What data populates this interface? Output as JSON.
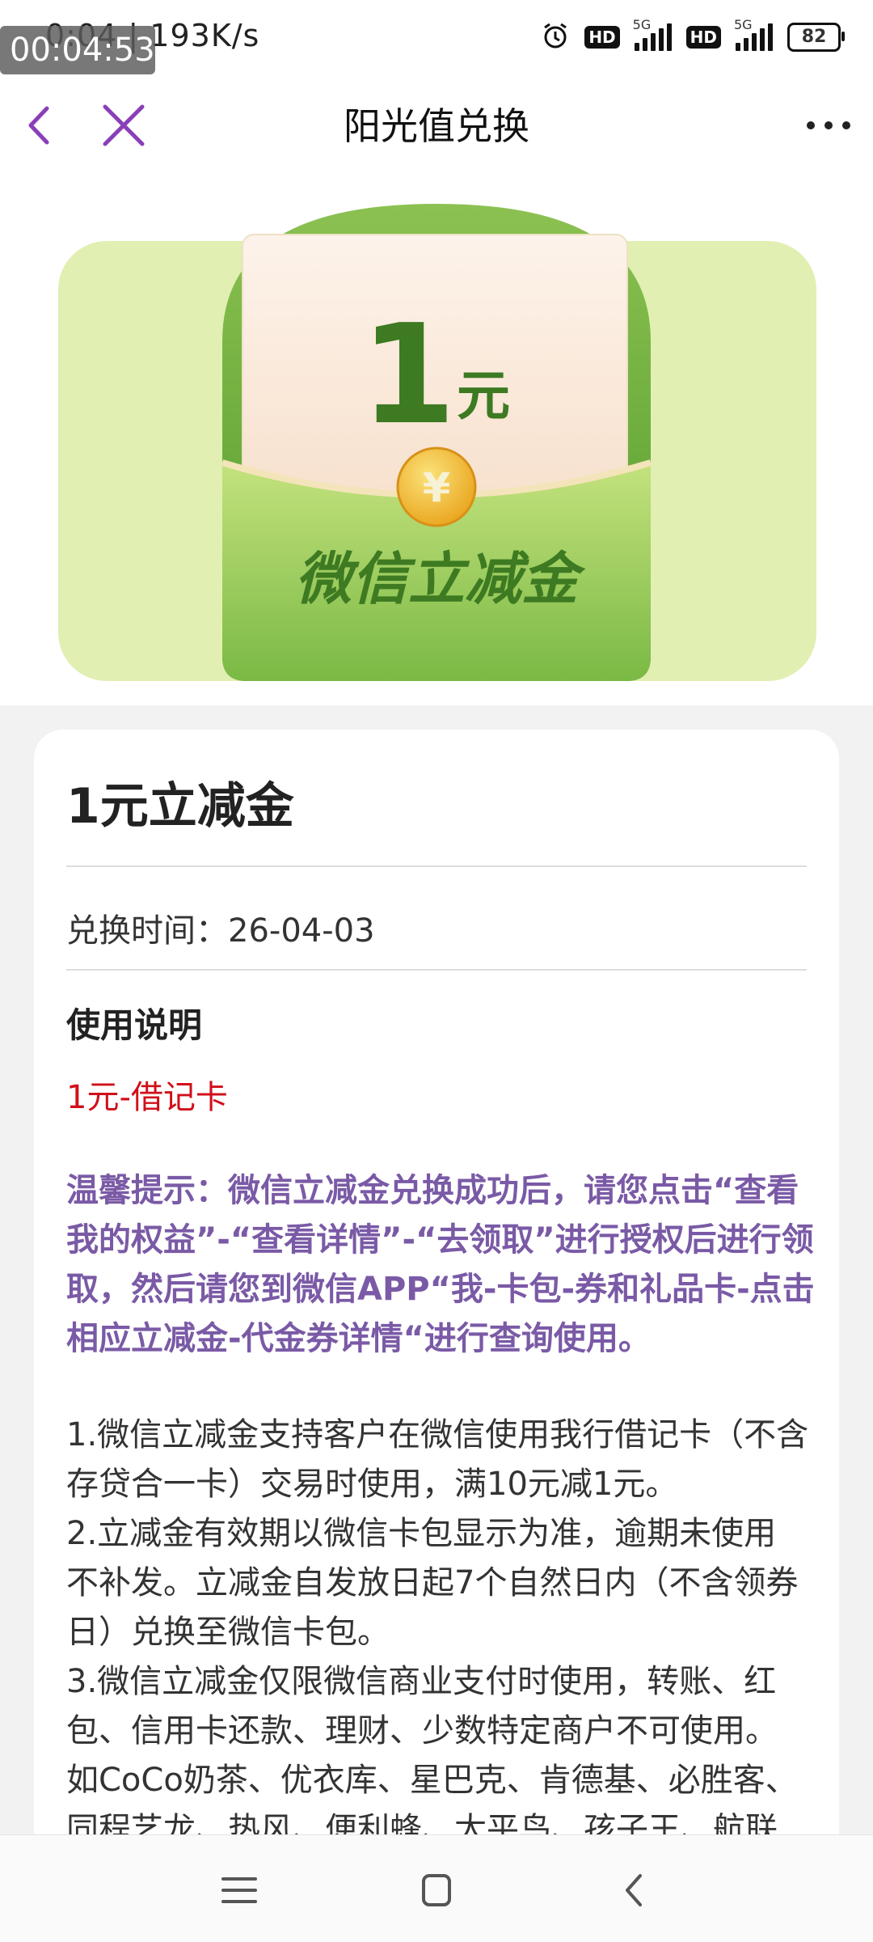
{
  "status_bar": {
    "time_speed": "0:04 | 193K/s",
    "recording_timer": "00:04:53",
    "battery": "82",
    "network_1": "5G",
    "network_2": "5G",
    "hd_1": "HD",
    "hd_2": "HD"
  },
  "nav": {
    "title": "阳光值兑换"
  },
  "banner": {
    "amount": "1",
    "unit": "元",
    "coin_symbol": "¥",
    "label": "微信立减金",
    "colors": {
      "bg": "#e1efb2",
      "envelope": "#6eaa3c",
      "text": "#3d7a22"
    }
  },
  "detail": {
    "title": "1元立减金",
    "exchange_time": "兑换时间：26-04-03",
    "usage_heading": "使用说明",
    "card_type": "1元-借记卡",
    "tip_lines": [
      "温馨提示：微信立减金兑换成功后，请您点击“查看",
      "我的权益”-“查看详情”-“去领取”进行授权后进行领",
      "取，然后请您到微信APP“我-卡包-券和礼品卡-点击",
      "相应立减金-代金券详情“进行查询使用。"
    ],
    "rule_lines": [
      "1.微信立减金支持客户在微信使用我行借记卡（不含",
      "存贷合一卡）交易时使用，满10元减1元。",
      "2.立减金有效期以微信卡包显示为准，逾期未使用",
      "不补发。立减金自发放日起7个自然日内（不含领券",
      "日）兑换至微信卡包。",
      "3.微信立减金仅限微信商业支付时使用，转账、红",
      "包、信用卡还款、理财、少数特定商户不可使用。",
      "如CoCo奶茶、优衣库、星巴克、肯德基、必胜客、",
      "同程艺龙、热风、便利蜂、太平鸟、孩子王、航联"
    ],
    "colors": {
      "tip": "#7a5aa6",
      "card_type": "#d0101a"
    }
  }
}
